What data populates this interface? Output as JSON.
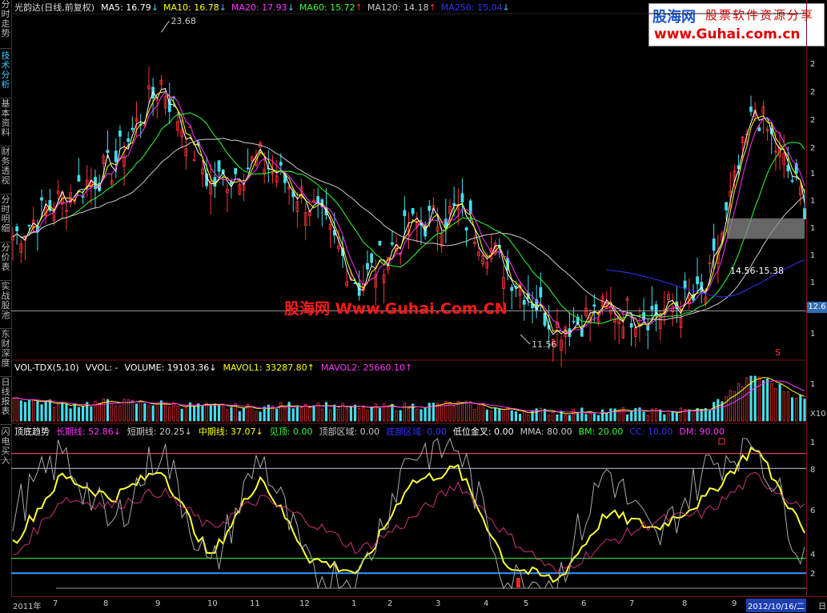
{
  "sidebar": {
    "tabs": [
      {
        "label": "分时走势",
        "active": false
      },
      {
        "label": "技术分析",
        "active": true
      },
      {
        "label": "基本资料",
        "active": false
      },
      {
        "label": "财务透视",
        "active": false
      },
      {
        "label": "分时明细",
        "active": false
      },
      {
        "label": "分价表",
        "active": false
      },
      {
        "label": "实战股池",
        "active": false
      },
      {
        "label": "东财深度",
        "active": false
      },
      {
        "label": "日线报表",
        "active": false
      },
      {
        "label": "闪电买入",
        "active": false
      }
    ]
  },
  "price_panel": {
    "title": "光韵达(日线,前复权)",
    "ma": [
      {
        "label": "MA5: 16.79",
        "arrow": "↓",
        "cls": "ma5",
        "arrow_cls": "dn"
      },
      {
        "label": "MA10: 16.78",
        "arrow": "↓",
        "cls": "ma10",
        "arrow_cls": "dn"
      },
      {
        "label": "MA20: 17.93",
        "arrow": "↓",
        "cls": "ma20",
        "arrow_cls": "dn"
      },
      {
        "label": "MA60: 15.72",
        "arrow": "↑",
        "cls": "ma60",
        "arrow_cls": "up"
      },
      {
        "label": "MA120: 14.18",
        "arrow": "↑",
        "cls": "ma120",
        "arrow_cls": "up"
      },
      {
        "label": "MA250: 15.04",
        "arrow": "↓",
        "cls": "ma250",
        "arrow_cls": "dn"
      }
    ],
    "high_label": "23.68",
    "low_label": "11.56",
    "range_label": "14.56-15.38",
    "current_price": "12.6",
    "s_marker": "S",
    "axis_ticks": [
      "2",
      "2",
      "2",
      "2",
      "1",
      "1",
      "1",
      "1",
      "1",
      "1",
      "1"
    ]
  },
  "logo": {
    "brand": "股海网",
    "slogan": "股票软件资源分享",
    "url": "www.Guhai.com.cn"
  },
  "watermark": "股海网 Www.Guhai.Com.CN",
  "volume_panel": {
    "items": [
      {
        "label": "VOL-TDX(5,10)",
        "cls": "ma5"
      },
      {
        "label": "VVOL: -",
        "cls": "ma5"
      },
      {
        "label": "VOLUME: 19103.36↓",
        "cls": "ma5"
      },
      {
        "label": "MAVOL1: 33287.80↑",
        "cls": "ma10"
      },
      {
        "label": "MAVOL2: 25660.10↑",
        "cls": "ma20"
      }
    ],
    "axis_ticks": [
      "1",
      "",
      "X10"
    ]
  },
  "indicator_panel": {
    "items": [
      {
        "label": "顶底趋势",
        "cls": "ma5"
      },
      {
        "label": "长期线: 52.86↓",
        "cls": "ma20"
      },
      {
        "label": "短期线: 20.25↓",
        "cls": "ma120"
      },
      {
        "label": "中期线: 37.07↓",
        "cls": "ma10"
      },
      {
        "label": "见顶: 0.00",
        "cls": "ma60"
      },
      {
        "label": "顶部区域: 0.00",
        "cls": "ma120"
      },
      {
        "label": "底部区域: 0.00",
        "cls": "ma250"
      },
      {
        "label": "低位金叉: 0.00",
        "cls": "ma5"
      },
      {
        "label": "MMA: 80.00",
        "cls": "ma120"
      },
      {
        "label": "BM: 20.00",
        "cls": "ma60"
      },
      {
        "label": "CC: 10.00",
        "cls": "ma250"
      },
      {
        "label": "DM: 90.00",
        "cls": "ma20"
      }
    ],
    "axis_ticks": [
      "1",
      "8",
      "6",
      "4",
      "2"
    ]
  },
  "xaxis": {
    "labels": [
      "2011年",
      "7",
      "8",
      "9",
      "10",
      "11",
      "12",
      "1",
      "2",
      "3",
      "4",
      "5",
      "6",
      "7",
      "8",
      "9"
    ],
    "current_date": "2012/10/16/二",
    "corner": "日"
  },
  "chart_data": [
    {
      "type": "line",
      "panel": "price",
      "title": "光韵达(日线,前复权)",
      "series": [
        {
          "name": "MA5",
          "color": "#ffffff"
        },
        {
          "name": "MA10",
          "color": "#ffff00"
        },
        {
          "name": "MA20",
          "color": "#ff33ff"
        },
        {
          "name": "MA60",
          "color": "#33ff33"
        },
        {
          "name": "MA120",
          "color": "#cccccc"
        },
        {
          "name": "MA250",
          "color": "#3333ff"
        }
      ],
      "x": [
        "2011-06",
        "2011-07",
        "2011-08",
        "2011-09",
        "2011-10",
        "2011-11",
        "2011-12",
        "2012-01",
        "2012-02",
        "2012-03",
        "2012-04",
        "2012-05",
        "2012-06",
        "2012-07",
        "2012-08",
        "2012-09",
        "2012-10"
      ],
      "close": [
        15.5,
        17.0,
        18.2,
        21.5,
        17.5,
        18.5,
        16.8,
        13.6,
        15.8,
        16.5,
        14.2,
        12.0,
        12.6,
        12.5,
        13.2,
        20.5,
        16.8
      ],
      "annotations": {
        "high": 23.68,
        "low": 11.56
      },
      "ylim": [
        11,
        24
      ]
    },
    {
      "type": "bar",
      "panel": "volume",
      "series": [
        {
          "name": "VOLUME",
          "values": [
            28,
            18,
            22,
            20,
            16,
            15,
            20,
            14,
            17,
            20,
            12,
            10,
            11,
            10,
            12,
            55,
            25
          ]
        }
      ]
    },
    {
      "type": "line",
      "panel": "indicator",
      "series": [
        {
          "name": "中期线",
          "values": [
            30,
            75,
            60,
            80,
            20,
            75,
            20,
            10,
            70,
            80,
            15,
            5,
            50,
            40,
            60,
            95,
            37
          ]
        },
        {
          "name": "长期线",
          "values": [
            20,
            60,
            55,
            65,
            40,
            60,
            45,
            25,
            45,
            70,
            35,
            10,
            30,
            45,
            50,
            75,
            53
          ]
        },
        {
          "name": "短期线",
          "values": [
            50,
            90,
            40,
            95,
            10,
            90,
            10,
            5,
            90,
            95,
            5,
            5,
            80,
            30,
            80,
            100,
            20
          ]
        }
      ],
      "ylim": [
        0,
        100
      ],
      "reference_lines": [
        90,
        80,
        20,
        10
      ]
    }
  ]
}
